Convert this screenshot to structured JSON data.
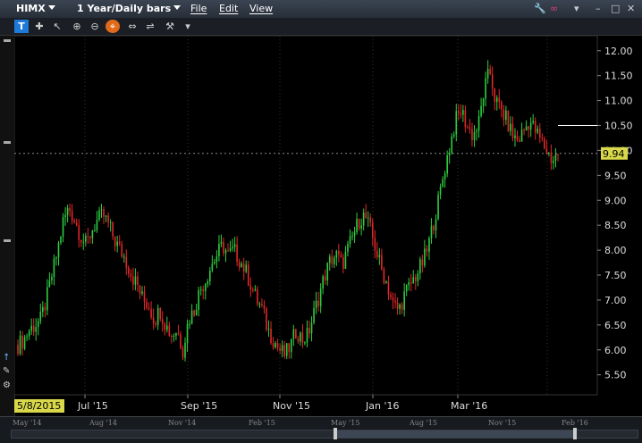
{
  "titlebar": {
    "symbol": "HIMX",
    "period": "1 Year/Daily bars",
    "menu": [
      "File",
      "Edit",
      "View"
    ]
  },
  "toolbar": {
    "chart_type_label": "T"
  },
  "chart_data": {
    "type": "candlestick",
    "y_ticks": [
      "12.00",
      "11.50",
      "11.00",
      "10.50",
      "10.00",
      "9.50",
      "9.00",
      "8.50",
      "8.00",
      "7.50",
      "7.00",
      "6.50",
      "6.00",
      "5.50"
    ],
    "x_ticks": [
      "Jul '15",
      "Sep '15",
      "Nov '15",
      "Jan '16",
      "Mar '16"
    ],
    "start_date_label": "5/8/2015",
    "last_price_label": "9.94",
    "last_price": 9.94,
    "horizontal_line": 10.5,
    "ylim": [
      5.1,
      12.3
    ],
    "closes": [
      6.1,
      6.2,
      6.4,
      6.5,
      6.6,
      7.0,
      7.5,
      8.0,
      8.6,
      8.85,
      8.6,
      8.3,
      8.1,
      8.4,
      8.6,
      8.7,
      8.5,
      8.2,
      8.0,
      7.8,
      7.5,
      7.3,
      7.0,
      6.9,
      6.6,
      6.8,
      6.5,
      6.3,
      6.4,
      6.0,
      6.6,
      6.8,
      7.2,
      7.4,
      7.7,
      7.9,
      8.1,
      7.9,
      8.0,
      7.8,
      7.6,
      7.3,
      7.0,
      6.8,
      6.4,
      6.2,
      6.0,
      5.9,
      6.1,
      6.4,
      6.2,
      6.3,
      6.7,
      7.1,
      7.5,
      7.8,
      7.9,
      7.7,
      8.0,
      8.3,
      8.6,
      8.7,
      8.4,
      8.0,
      7.6,
      7.3,
      6.9,
      6.8,
      7.1,
      7.3,
      7.5,
      7.7,
      8.0,
      8.5,
      9.0,
      9.6,
      10.1,
      10.6,
      10.8,
      10.5,
      10.3,
      10.5,
      11.2,
      11.6,
      11.0,
      10.8,
      10.6,
      10.3,
      10.2,
      10.4,
      10.6,
      10.4,
      10.2,
      10.0,
      9.8,
      9.94
    ]
  },
  "navigator": {
    "labels": [
      "May '14",
      "Aug '14",
      "Nov '14",
      "Feb '15",
      "May '15",
      "Aug '15",
      "Nov '15",
      "Feb '16"
    ]
  }
}
